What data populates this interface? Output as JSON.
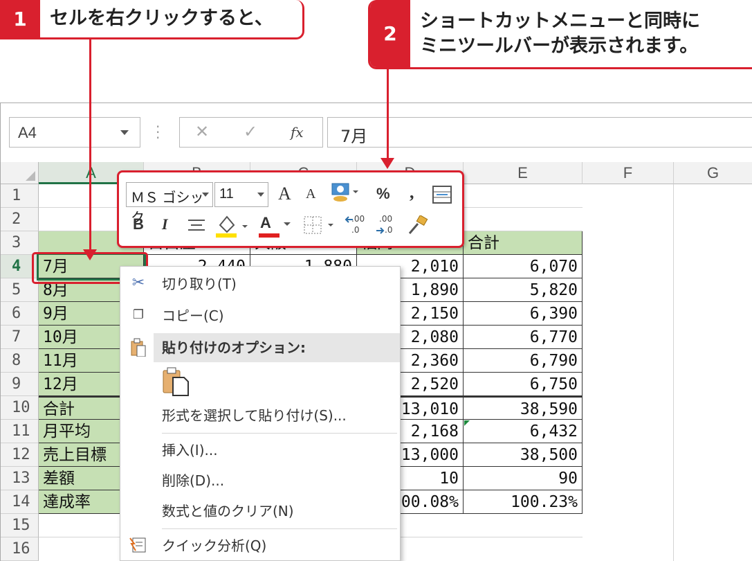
{
  "callouts": [
    {
      "num": "1",
      "text": "セルを右クリックすると、"
    },
    {
      "num": "2",
      "line1": "ショートカットメニューと同時に",
      "line2": "ミニツールバーが表示されます。"
    }
  ],
  "formula_bar": {
    "name_box": "A4",
    "cancel_icon": "✕",
    "enter_icon": "✓",
    "fx_label": "fx",
    "formula": "7月"
  },
  "columns": [
    "A",
    "B",
    "C",
    "D",
    "E",
    "F",
    "G"
  ],
  "rows": [
    "1",
    "2",
    "3",
    "4",
    "5",
    "6",
    "7",
    "8",
    "9",
    "10",
    "11",
    "12",
    "13",
    "14",
    "15",
    "16"
  ],
  "table": {
    "headers": {
      "b": "目白屋",
      "c": "大阪",
      "d": "福岡",
      "e": "合計"
    },
    "labels": [
      "7月",
      "8月",
      "9月",
      "10月",
      "11月",
      "12月",
      "合計",
      "月平均",
      "売上目標",
      "差額",
      "達成率"
    ],
    "b_visible": [
      "2,440",
      "1,880"
    ],
    "d_values": [
      "2,010",
      "1,890",
      "2,150",
      "2,080",
      "2,360",
      "2,520",
      "13,010",
      "2,168",
      "13,000",
      "10",
      "100.08%"
    ],
    "e_values": [
      "6,070",
      "5,820",
      "6,390",
      "6,770",
      "6,790",
      "6,750",
      "38,590",
      "6,432",
      "38,500",
      "90",
      "100.23%"
    ]
  },
  "mini_toolbar": {
    "font_name": "ＭＳ ゴシック",
    "font_size": "11",
    "grow_font": "A",
    "shrink_font": "A",
    "percent": "%",
    "comma": ",",
    "bold": "B",
    "italic": "I",
    "font_color": "A",
    "inc_decimal": ".00",
    "dec_decimal": ".0"
  },
  "context_menu": {
    "cut": "切り取り(T)",
    "copy": "コピー(C)",
    "paste_options": "貼り付けのオプション:",
    "paste_special": "形式を選択して貼り付け(S)...",
    "insert": "挿入(I)...",
    "delete": "削除(D)...",
    "clear": "数式と値のクリア(N)",
    "quick_analysis": "クイック分析(Q)"
  },
  "colors": {
    "accent_red": "#d9202e",
    "excel_green": "#217346",
    "cell_green": "#c6e0b4"
  }
}
